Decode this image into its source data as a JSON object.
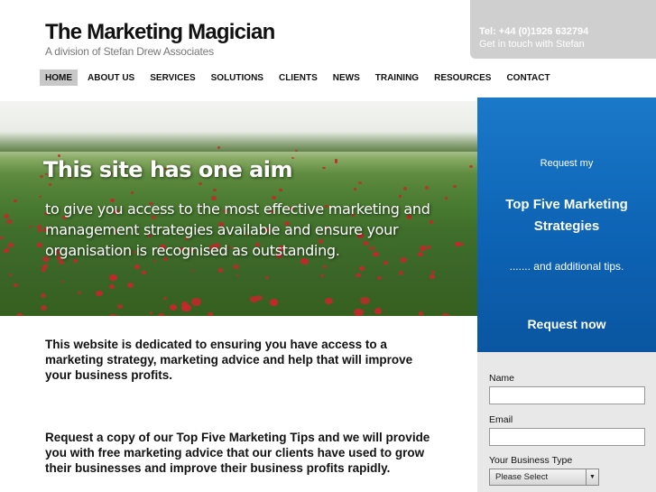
{
  "brand": {
    "title": "The Marketing Magician",
    "subtitle": "A division of Stefan Drew Associates"
  },
  "contact": {
    "tel": "Tel: +44 (0)1926 632794",
    "cta": "Get in touch with Stefan"
  },
  "nav": {
    "items": [
      {
        "label": "HOME",
        "active": true
      },
      {
        "label": "ABOUT US"
      },
      {
        "label": "SERVICES"
      },
      {
        "label": "SOLUTIONS"
      },
      {
        "label": "CLIENTS"
      },
      {
        "label": "NEWS"
      },
      {
        "label": "TRAINING"
      },
      {
        "label": "RESOURCES"
      },
      {
        "label": "CONTACT"
      }
    ]
  },
  "hero": {
    "heading": "This site has one aim",
    "text": "to give you access to the most effective marketing and management strategies available and ensure your organisation is recognised as outstanding."
  },
  "promo": {
    "request_my": "Request my",
    "heading": "Top Five Marketing Strategies",
    "tips": "....... and additional tips.",
    "button": "Request now"
  },
  "form": {
    "name_label": "Name",
    "email_label": "Email",
    "type_label": "Your Business Type",
    "type_selected": "Please Select"
  },
  "main": {
    "para1": "This website is dedicated to ensuring you have access to a marketing strategy, marketing advice and help that will improve your business profits.",
    "para2": "Request a copy of our Top Five Marketing Tips and we will provide you with free marketing advice that our clients have used to grow their businesses and improve their business profits rapidly."
  },
  "colors": {
    "promo_blue": "#0d63b4",
    "nav_active": "#c8c8c8",
    "contact_box": "#cfcfcf"
  }
}
